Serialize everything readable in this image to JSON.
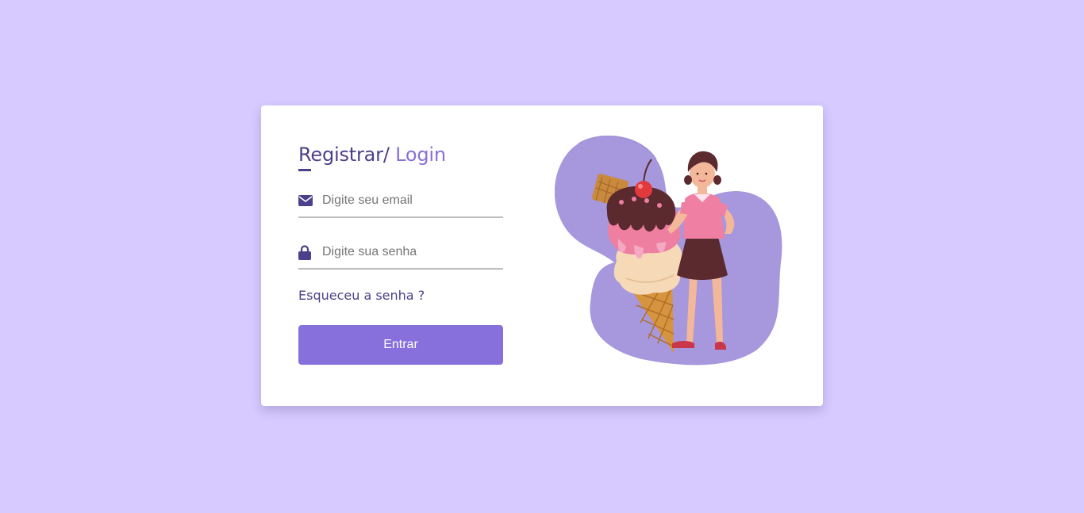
{
  "login_form": {
    "title_primary": "Registrar/",
    "title_accent": " Login",
    "email_placeholder": "Digite seu email",
    "email_value": "",
    "password_placeholder": "Digite sua senha",
    "password_value": "",
    "forgot_password": "Esqueceu a senha ?",
    "submit_label": "Entrar",
    "icons": {
      "email": "envelope-icon",
      "password": "lock-icon"
    }
  },
  "illustration": {
    "subject": "girl-with-ice-cream-cone"
  },
  "colors": {
    "background": "#d6caff",
    "card": "#ffffff",
    "primary_dark": "#4e3f8a",
    "accent": "#8a70d6",
    "button": "#8770dc",
    "blob": "#a797dc"
  }
}
